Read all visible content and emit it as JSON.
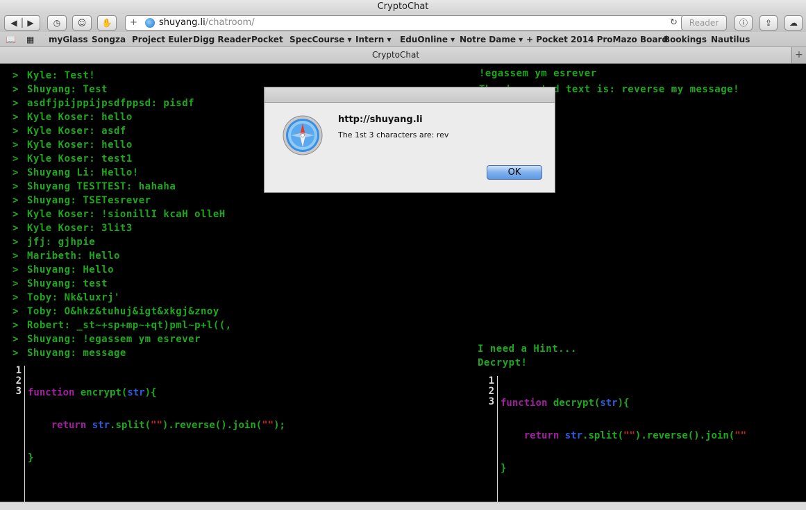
{
  "window": {
    "title": "CryptoChat"
  },
  "toolbar": {
    "url_host": "shuyang.li",
    "url_path": "/chatroom/",
    "reader_label": "Reader"
  },
  "bookmarks": [
    "myGlass",
    "Songza",
    "Project Euler",
    "Digg Reader",
    "Pocket",
    "SpecCourse ▾",
    "Intern ▾",
    "EduOnline ▾",
    "Notre Dame ▾",
    "+ Pocket",
    "2014 ProMazo Board",
    "Bookings",
    "Nautilus"
  ],
  "tab": {
    "label": "CryptoChat"
  },
  "chat": {
    "prompt": ">",
    "messages": [
      "Kyle: Test!",
      "Shuyang: Test",
      "asdfjpijppijpsdfppsd: pisdf",
      "Kyle Koser: hello",
      "Kyle Koser: asdf",
      "Kyle Koser: hello",
      "Kyle Koser: test1",
      "Shuyang Li: Hello!",
      "Shuyang TESTTEST: hahaha",
      "Shuyang: TSETesrever",
      "Kyle Koser: !sionillI kcaH olleH",
      "Kyle Koser: 3lit3",
      "jfj: gjhpie",
      "Maribeth: Hello",
      "Shuyang: Hello",
      "Shuyang: test",
      "Toby: Nk&luxrj'",
      "Toby: O&hkz&tuhuj&igt&xkgj&znoy",
      "Robert: _st~+sp+mp~+qt)pml~p+l((,",
      "Shuyang: !egassem ym esrever"
    ],
    "input_value": "Shuyang: message"
  },
  "right_panel": {
    "reversed_line": "!egassem ym esrever",
    "decrypted_line": "The decrypted text is: reverse my message!",
    "hint_label": "I need a Hint...",
    "decrypt_label": "Decrypt!"
  },
  "encrypt_editor": {
    "line_numbers": [
      "1",
      "2",
      "3"
    ]
  },
  "decrypt_editor": {
    "line_numbers": [
      "1",
      "2",
      "3"
    ]
  },
  "dialog": {
    "title": "http://shuyang.li",
    "message": "The 1st 3 characters are: rev",
    "ok_label": "OK"
  }
}
